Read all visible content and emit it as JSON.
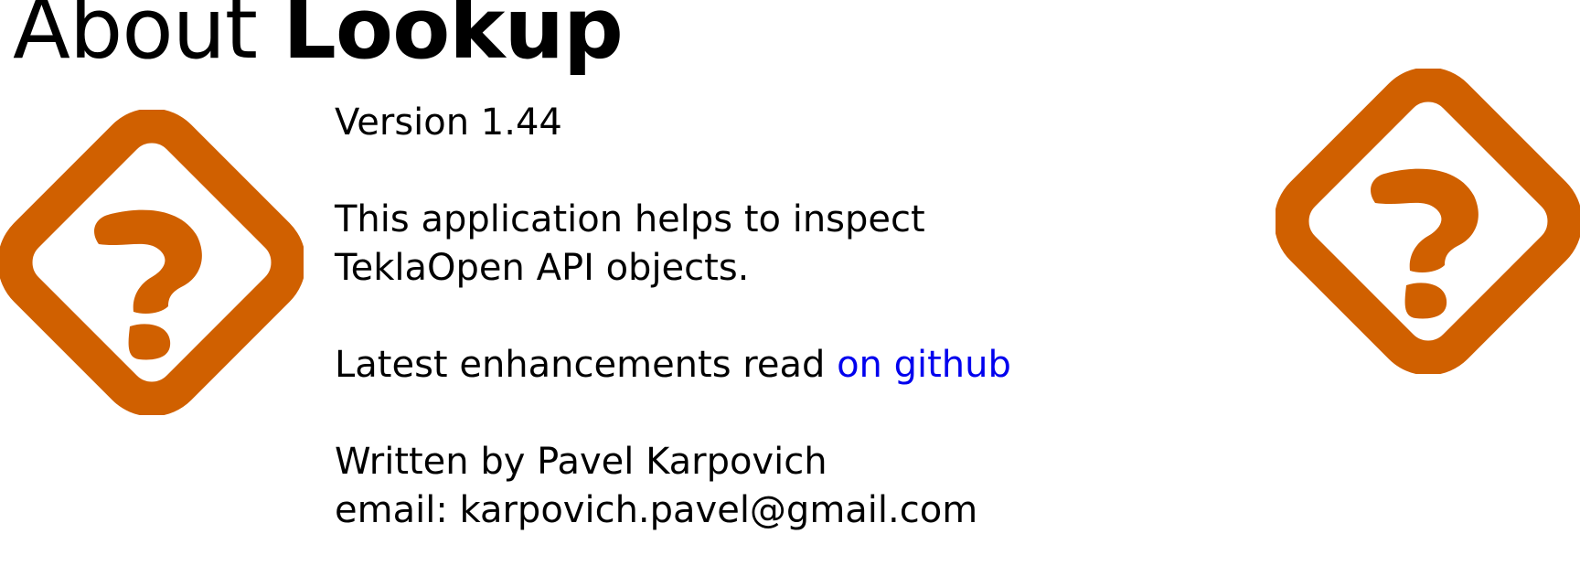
{
  "header": {
    "title_prefix": "About",
    "title_app": "Lookup"
  },
  "icons": {
    "left": "help-diamond-icon",
    "right": "help-diamond-icon",
    "color": "#d06000"
  },
  "about": {
    "version": "Version 1.44",
    "description": "This application helps to inspect TeklaOpen API objects.",
    "enhancements_text": "Latest enhancements read ",
    "enhancements_link": "on github",
    "author": "Written by Pavel Karpovich",
    "email": "email: karpovich.pavel@gmail.com"
  },
  "colors": {
    "link": "#0000ee",
    "text": "#000000",
    "background": "#ffffff"
  }
}
